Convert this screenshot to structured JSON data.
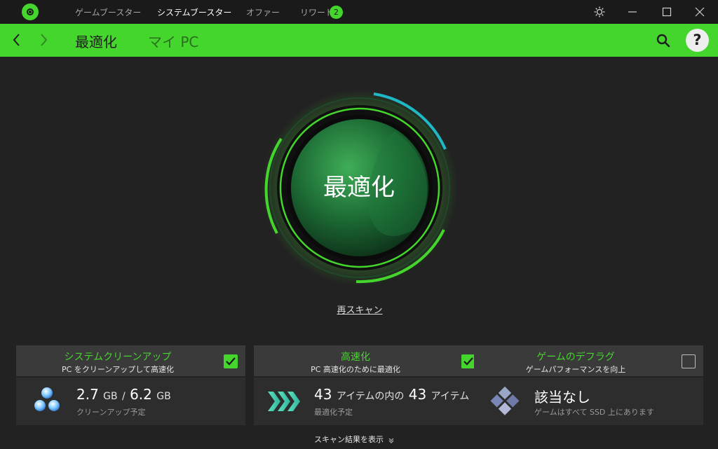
{
  "topbar": {
    "tabs": [
      {
        "label": "ゲームブースター"
      },
      {
        "label": "システムブースター"
      },
      {
        "label": "オファー"
      },
      {
        "label": "リワード"
      }
    ],
    "rewards_badge": "2"
  },
  "nav": {
    "tabs": [
      {
        "label": "最適化"
      },
      {
        "label": "マイ PC"
      }
    ],
    "help_label": "?"
  },
  "gauge": {
    "label": "最適化"
  },
  "rescan_link": "再スキャン",
  "cards": [
    {
      "title": "システムクリーンアップ",
      "subtitle": "PC をクリーンアップして高速化",
      "checked": true,
      "value_a": "2.7",
      "unit_a": "GB",
      "separator": "/",
      "value_b": "6.2",
      "unit_b": "GB",
      "note": "クリーンアップ予定"
    },
    {
      "title": "高速化",
      "subtitle": "PC 高速化のために最適化",
      "checked": true,
      "value_a": "43",
      "text_mid": "アイテムの内の",
      "value_b": "43",
      "text_end": "アイテム",
      "note": "最適化予定"
    },
    {
      "title": "ゲームのデフラグ",
      "subtitle": "ゲームパフォーマンスを向上",
      "checked": false,
      "value": "該当なし",
      "note": "ゲームはすべて SSD 上にあります"
    }
  ],
  "show_results": "スキャン結果を表示",
  "colors": {
    "accent": "#44d62c",
    "background": "#222222",
    "card_head": "#3a3a3a",
    "card_body": "#2d2d2d",
    "ring_cyan": "#1fb8c6"
  }
}
